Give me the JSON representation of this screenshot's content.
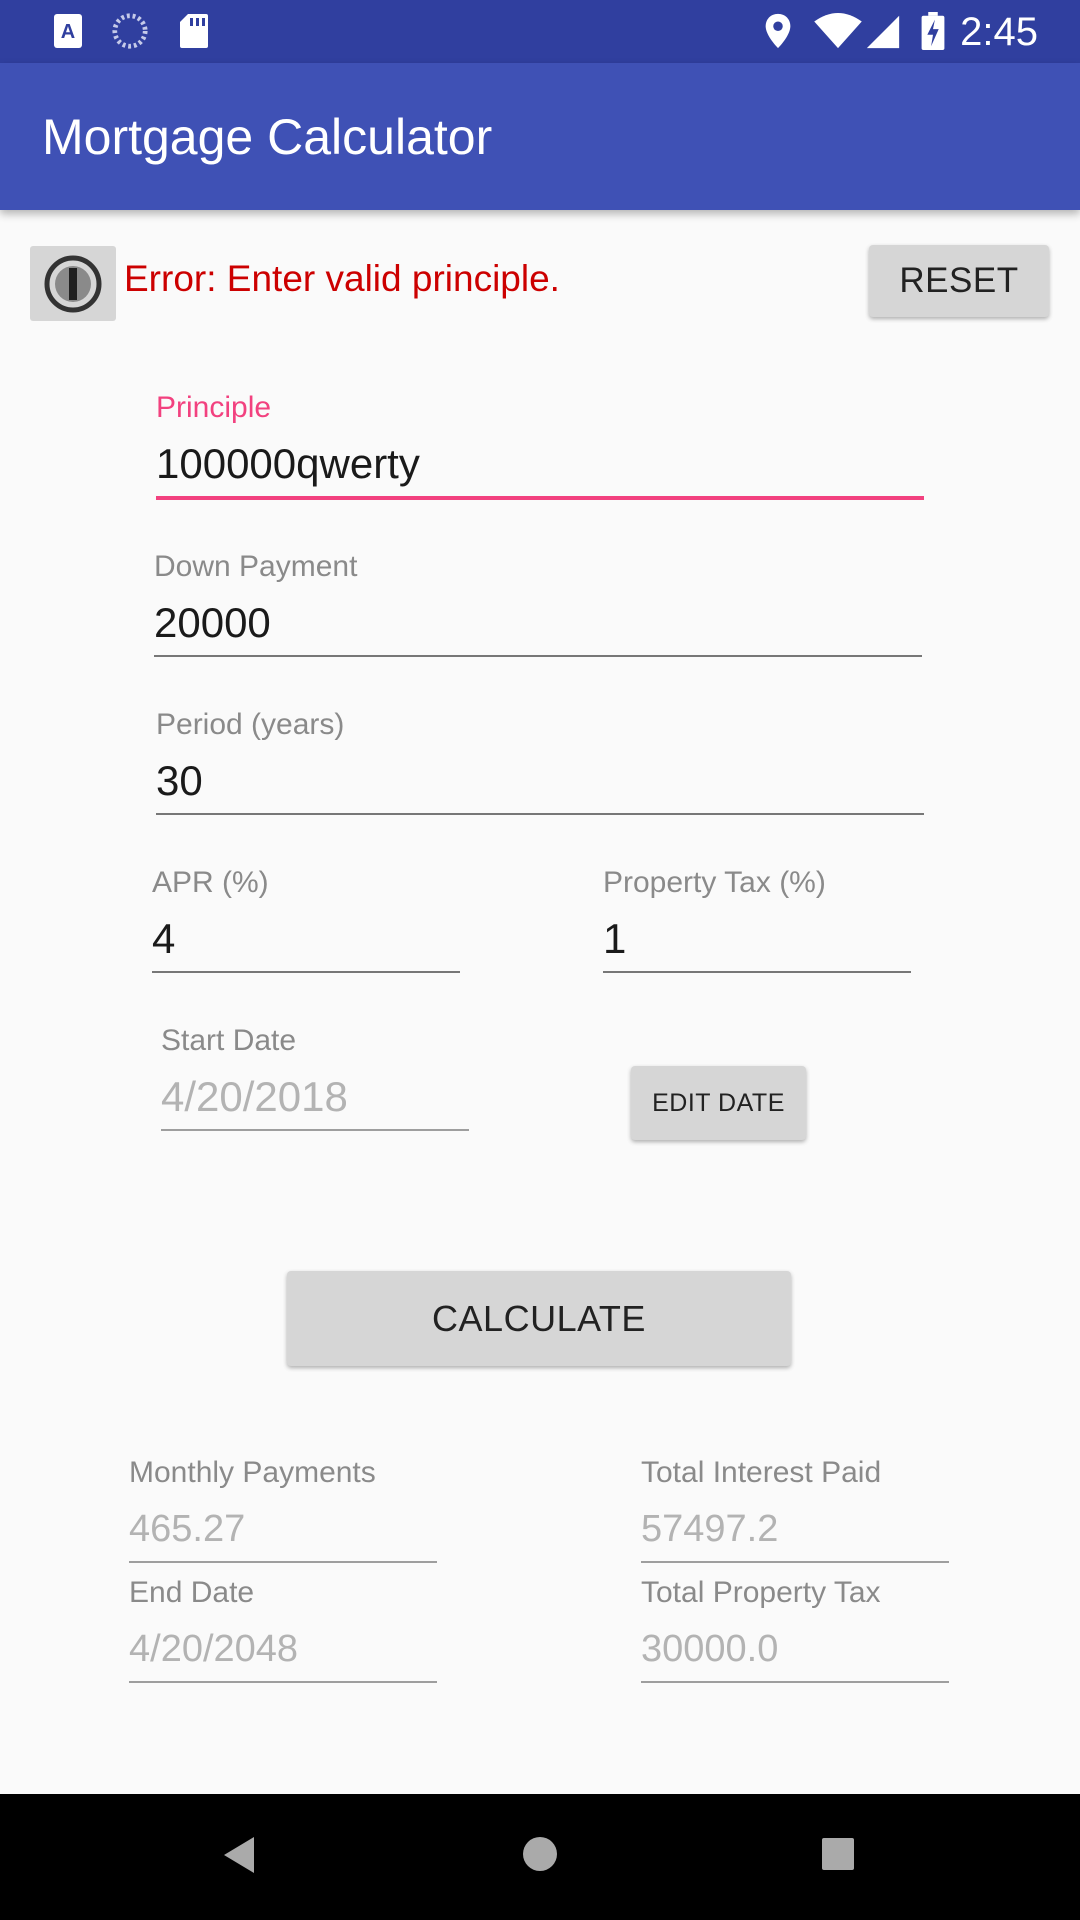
{
  "status_bar": {
    "time": "2:45",
    "icons_left": [
      "app-a-icon",
      "loading-icon",
      "sd-card-icon"
    ],
    "icons_right": [
      "location-icon",
      "wifi-icon",
      "signal-icon",
      "battery-charging-icon"
    ],
    "background": "#303f9f"
  },
  "app_bar": {
    "title": "Mortgage Calculator",
    "background": "#3f51b5"
  },
  "error_row": {
    "info_icon": "info-icon",
    "error_text": "Error: Enter valid principle.",
    "error_color": "#cc0000",
    "reset_label": "RESET"
  },
  "form": {
    "principle": {
      "label": "Principle",
      "value": "100000qwerty"
    },
    "down_payment": {
      "label": "Down Payment",
      "value": "20000"
    },
    "period": {
      "label": "Period (years)",
      "value": "30"
    },
    "apr": {
      "label": "APR (%)",
      "value": "4"
    },
    "property_tax": {
      "label": "Property Tax (%)",
      "value": "1"
    },
    "start_date": {
      "label": "Start Date",
      "value": "4/20/2018"
    },
    "edit_date_label": "EDIT DATE",
    "calculate_label": "CALCULATE",
    "accent_color": "#f2417f"
  },
  "results": {
    "monthly_payments": {
      "label": "Monthly Payments",
      "value": "465.27"
    },
    "total_interest": {
      "label": "Total Interest Paid",
      "value": "57497.2"
    },
    "end_date": {
      "label": "End Date",
      "value": "4/20/2048"
    },
    "total_property_tax": {
      "label": "Total Property Tax",
      "value": "30000.0"
    }
  },
  "nav_bar": {
    "icons": [
      "back-icon",
      "home-icon",
      "recents-icon"
    ]
  }
}
